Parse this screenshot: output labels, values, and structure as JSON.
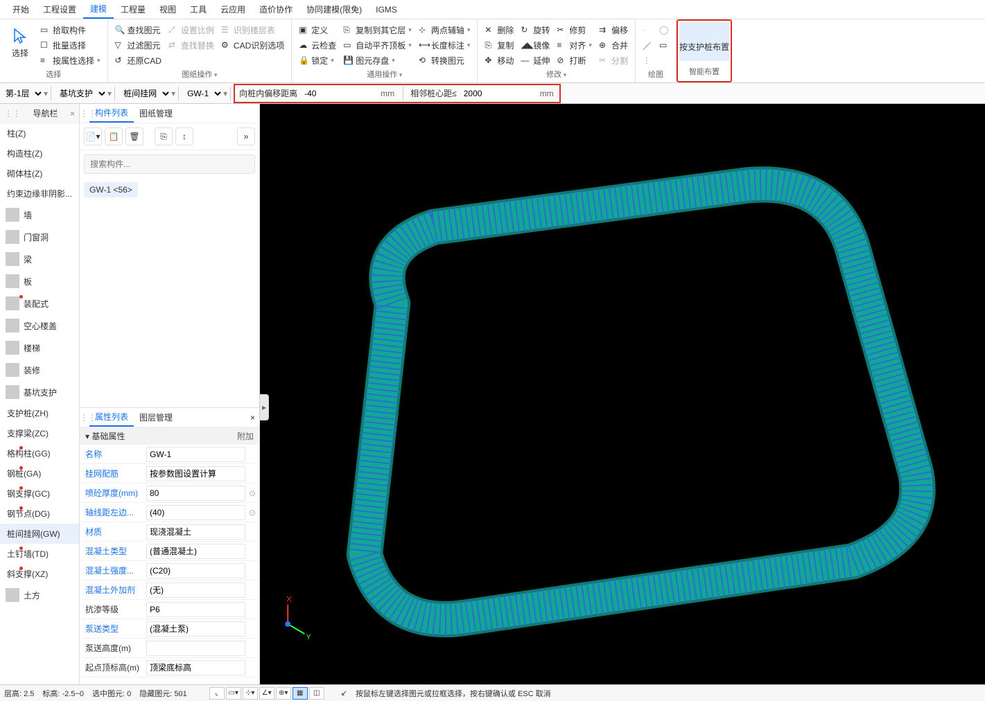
{
  "menu": [
    "开始",
    "工程设置",
    "建模",
    "工程量",
    "视图",
    "工具",
    "云应用",
    "造价协作",
    "协同建模(限免)",
    "IGMS"
  ],
  "menu_active": 2,
  "ribbon": {
    "sel_group": {
      "big": "选择",
      "items": [
        "拾取构件",
        "批量选择",
        "按属性选择"
      ]
    },
    "find_group": {
      "items": [
        "查找图元",
        "过滤图元",
        "还原CAD",
        "设置比例",
        "识别楼层表",
        "查找替换",
        "CAD识别选项"
      ],
      "label": "图纸操作"
    },
    "common_group": {
      "items": [
        "定义",
        "云检查",
        "锁定",
        "复制到其它层",
        "自动平齐顶板",
        "图元存盘",
        "两点辅轴",
        "长度标注",
        "转换图元"
      ],
      "label": "通用操作"
    },
    "modify_group": {
      "items": [
        "删除",
        "复制",
        "移动",
        "旋转",
        "镜像",
        "延伸",
        "修剪",
        "对齐",
        "打断",
        "偏移",
        "合并",
        "分割"
      ],
      "label": "修改"
    },
    "draw_group": {
      "label": "绘图"
    },
    "smart_group": {
      "btn": "按支护桩布置",
      "label": "智能布置"
    }
  },
  "subbar": {
    "floor": "第-1层",
    "cat": "基坑支护",
    "type": "桩间挂网",
    "comp": "GW-1",
    "p1_label": "向桩内偏移距离",
    "p1_val": "-40",
    "p1_unit": "mm",
    "p2_label": "相邻桩心距≤",
    "p2_val": "2000",
    "p2_unit": "mm"
  },
  "nav": {
    "title": "导航栏",
    "top": [
      "柱(Z)",
      "构造柱(Z)",
      "砌体柱(Z)",
      "约束边缘非阴影..."
    ],
    "cats": [
      {
        "label": "墙"
      },
      {
        "label": "门窗洞"
      },
      {
        "label": "梁"
      },
      {
        "label": "板"
      },
      {
        "label": "装配式",
        "dot": true
      },
      {
        "label": "空心楼盖"
      },
      {
        "label": "楼梯"
      },
      {
        "label": "装修"
      },
      {
        "label": "基坑支护",
        "open": true,
        "children": [
          {
            "label": "支护桩(ZH)"
          },
          {
            "label": "支撑梁(ZC)"
          },
          {
            "label": "格构柱(GG)",
            "dot": true
          },
          {
            "label": "钢桩(GA)",
            "dot": true
          },
          {
            "label": "钢支撑(GC)",
            "dot": true
          },
          {
            "label": "钢节点(DG)",
            "dot": true
          },
          {
            "label": "桩间挂网(GW)",
            "sel": true
          },
          {
            "label": "土钉墙(TD)",
            "dot": true
          },
          {
            "label": "斜支撑(XZ)",
            "dot": true
          }
        ]
      },
      {
        "label": "土方"
      }
    ]
  },
  "complist": {
    "tabs": [
      "构件列表",
      "图纸管理"
    ],
    "search_ph": "搜索构件...",
    "item": "GW-1  <56>"
  },
  "proplist": {
    "tabs": [
      "属性列表",
      "图层管理"
    ],
    "section": "基础属性",
    "section_extra": "附加",
    "rows": [
      {
        "name": "名称",
        "val": "GW-1",
        "link": true
      },
      {
        "name": "挂网配筋",
        "val": "按参数图设置计算",
        "link": true
      },
      {
        "name": "喷砼厚度(mm)",
        "val": "80",
        "link": true,
        "ex": "⊙"
      },
      {
        "name": "轴线距左边...",
        "val": "(40)",
        "link": true,
        "ex": "⊙"
      },
      {
        "name": "材质",
        "val": "现浇混凝土",
        "link": true
      },
      {
        "name": "混凝土类型",
        "val": "(普通混凝土)",
        "link": true
      },
      {
        "name": "混凝土强度...",
        "val": "(C20)",
        "link": true
      },
      {
        "name": "混凝土外加剂",
        "val": "(无)",
        "link": true
      },
      {
        "name": "抗渗等级",
        "val": "P6"
      },
      {
        "name": "泵送类型",
        "val": "(混凝土泵)",
        "link": true
      },
      {
        "name": "泵送高度(m)",
        "val": ""
      },
      {
        "name": "起点顶标高(m)",
        "val": "顶梁底标高"
      }
    ]
  },
  "status": {
    "floor_h": "层高:  2.5",
    "elev": "标高:   -2.5~0",
    "sel": "选中图元:  0",
    "hidden": "隐藏图元:  501",
    "hint": "按鼠标左键选择图元或拉框选择，按右键确认或 ESC 取消"
  }
}
